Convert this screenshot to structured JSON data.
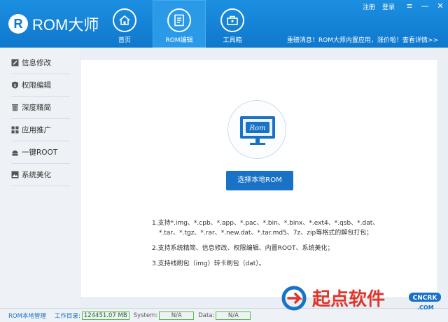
{
  "app": {
    "name": "ROM大师",
    "logo_letter": "R"
  },
  "nav_tabs": [
    {
      "label": "首页",
      "icon": "home-icon"
    },
    {
      "label": "ROM编辑",
      "icon": "edit-icon",
      "active": true
    },
    {
      "label": "工具箱",
      "icon": "toolbox-icon"
    }
  ],
  "top_links": {
    "register": "注册",
    "login": "登录"
  },
  "window": {
    "menu": "≡",
    "minimize": "—",
    "close": "✕"
  },
  "announcement": "重磅消息！ROM大师内置应用，涨价啦！查看详情>>",
  "sidebar": [
    {
      "label": "信息修改",
      "icon": "edit-icon"
    },
    {
      "label": "权限编辑",
      "icon": "shield-icon"
    },
    {
      "label": "深度精简",
      "icon": "trash-icon"
    },
    {
      "label": "应用推广",
      "icon": "apps-icon"
    },
    {
      "label": "一键ROOT",
      "icon": "android-icon"
    },
    {
      "label": "系统美化",
      "icon": "image-icon"
    }
  ],
  "main": {
    "monitor_text": "Rom",
    "select_button": "选择本地ROM",
    "desc1a": "1.支持*.img、*.cpb、*.app、*.pac、*.bin、*.binx、*.ext4、*.qsb、*.dat、",
    "desc1b": "*.tar、*.tgz、*.rar、*.new.dat、*.tar.md5、7z、zip等格式的解包打包；",
    "desc2": "2.支持系统精简、信息修改、权限编辑、内置ROOT、系统美化；",
    "desc3": "3.支持线刷包（img）转卡刷包（dat）。"
  },
  "status_bar": {
    "rom_manage": "ROM本地管理",
    "workdir_label": "工作目录:",
    "workdir_value": "124451.07 MB",
    "system_label": "System:",
    "system_value": "N/A",
    "data_label": "Data:",
    "data_value": "N/A"
  },
  "watermark": {
    "brand": "起点软件",
    "tag": "CNCRK",
    "suffix": ".COM"
  },
  "colors": {
    "header": "#1283d8",
    "accent": "#1a72c6",
    "status_green": "#5fb94a",
    "watermark_red": "#e2342b",
    "watermark_blue": "#1a72c6"
  }
}
